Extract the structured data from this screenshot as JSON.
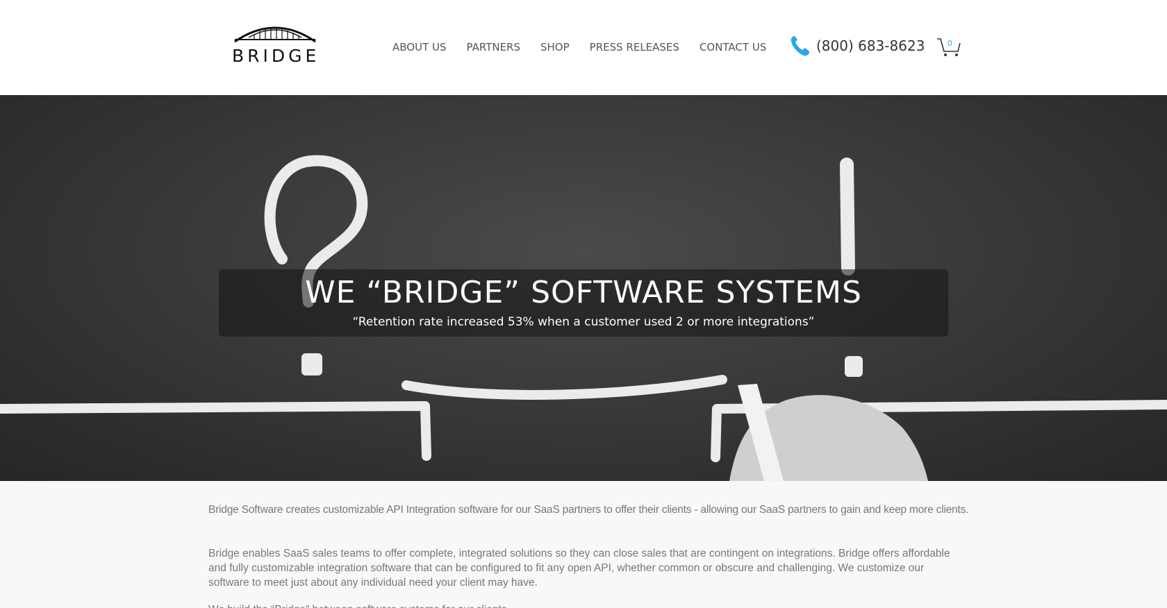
{
  "brand": {
    "logo_text": "BRIDGE"
  },
  "nav": {
    "items": [
      "ABOUT US",
      "PARTNERS",
      "SHOP",
      "PRESS RELEASES",
      "CONTACT US"
    ]
  },
  "contact": {
    "phone": "(800) 683-8623",
    "phone_icon": "phone-icon",
    "icon_color": "#2aa7e8"
  },
  "cart": {
    "count": "0",
    "icon": "cart-icon"
  },
  "hero": {
    "title": "WE “BRIDGE” SOFTWARE SYSTEMS",
    "quote": "“Retention rate increased 53% when a customer used 2 or more integrations”"
  },
  "content": {
    "paragraphs": [
      "Bridge Software creates customizable API Integration software for our SaaS partners to offer their clients - allowing our SaaS partners to gain and keep more clients.",
      "Bridge enables SaaS sales teams to offer complete, integrated solutions so they can close sales that are contingent on integrations. Bridge offers affordable and fully customizable integration software that can be configured to fit any open API, whether common or obscure and challenging.  We customize our software to meet just about any individual need your client may have.",
      "We build the “Bridge” between software systems for our clients."
    ]
  }
}
